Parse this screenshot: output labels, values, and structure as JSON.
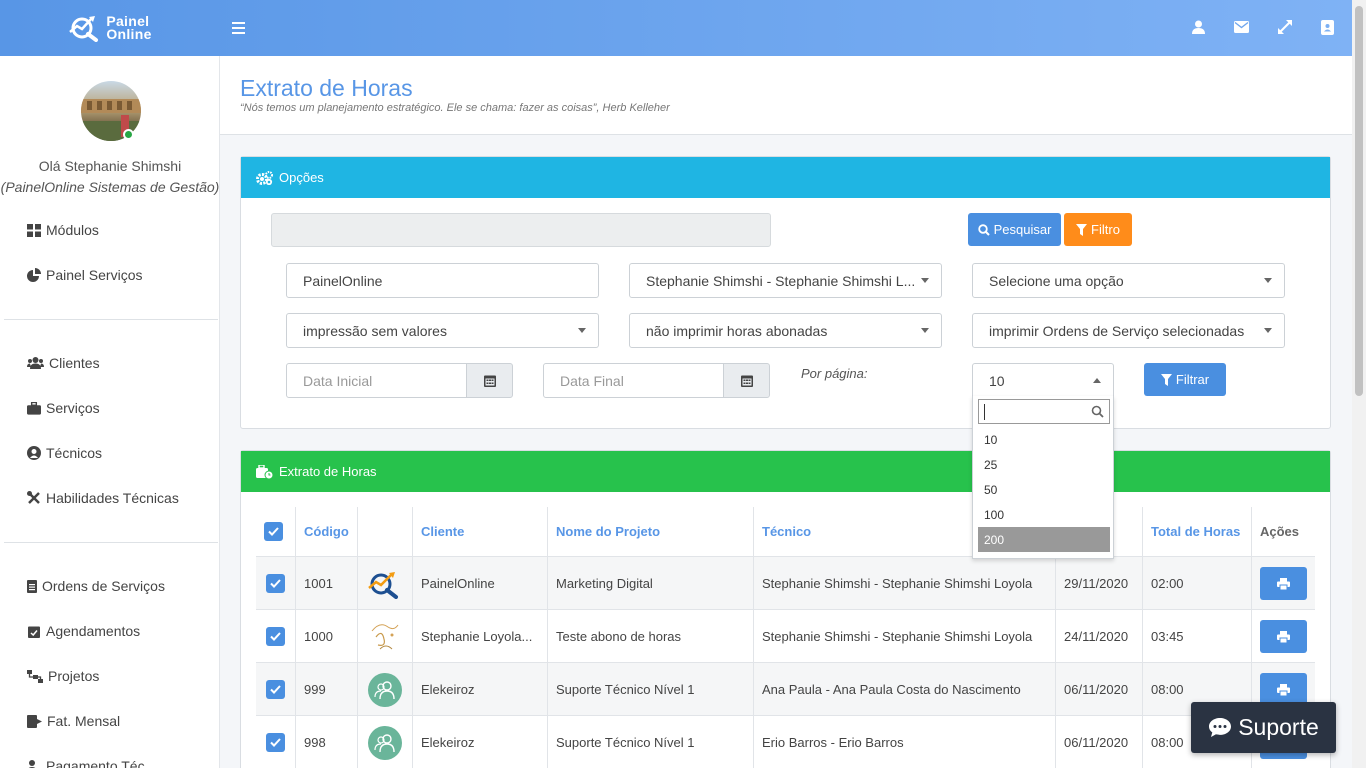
{
  "brand": {
    "line1": "Painel",
    "line2": "Online"
  },
  "topbar": {
    "icons": [
      "user-icon",
      "envelope-icon",
      "expand-icon",
      "address-book-icon"
    ]
  },
  "sidebar": {
    "greeting": "Olá Stephanie Shimshi",
    "company": "(PainelOnline Sistemas de Gestão)",
    "items": [
      {
        "label": "Módulos",
        "icon": "grid-icon"
      },
      {
        "label": "Painel Serviços",
        "icon": "pie-chart-icon"
      },
      {
        "label": "Clientes",
        "icon": "users-icon"
      },
      {
        "label": "Serviços",
        "icon": "briefcase-icon"
      },
      {
        "label": "Técnicos",
        "icon": "user-circle-icon"
      },
      {
        "label": "Habilidades Técnicas",
        "icon": "tools-icon"
      },
      {
        "label": "Ordens de Serviços",
        "icon": "file-list-icon"
      },
      {
        "label": "Agendamentos",
        "icon": "calendar-check-icon"
      },
      {
        "label": "Projetos",
        "icon": "sitemap-icon"
      },
      {
        "label": "Fat. Mensal",
        "icon": "file-export-icon"
      },
      {
        "label": "Pagamento Téc.",
        "icon": "user-money-icon"
      }
    ]
  },
  "page": {
    "title": "Extrato de Horas",
    "quote": "“Nós temos um planejamento estratégico. Ele se chama: fazer as coisas”, Herb Kelleher"
  },
  "options": {
    "header": "Opções",
    "search_button": "Pesquisar",
    "filter_button": "Filtro",
    "client_select": "PainelOnline",
    "technician_select": "Stephanie Shimshi - Stephanie Shimshi L...",
    "option_select": "Selecione uma opção",
    "print_values_select": "impressão sem valores",
    "hours_select": "não imprimir horas abonadas",
    "orders_select": "imprimir Ordens de Serviço selecionadas",
    "start_date_placeholder": "Data Inicial",
    "end_date_placeholder": "Data Final",
    "per_page_label": "Por página:",
    "per_page_value": "10",
    "per_page_options": [
      "10",
      "25",
      "50",
      "100",
      "200"
    ],
    "per_page_highlighted": "200",
    "apply_button": "Filtrar"
  },
  "table_card": {
    "header": "Extrato de Horas",
    "columns": [
      "Código",
      "Cliente",
      "Nome do Projeto",
      "Técnico",
      "Total de Horas",
      "Ações"
    ],
    "rows": [
      {
        "code": "1001",
        "logo": "painelonline-logo",
        "client": "PainelOnline",
        "project": "Marketing Digital",
        "technician": "Stephanie Shimshi - Stephanie Shimshi Loyola",
        "date": "29/11/2020",
        "hours": "02:00"
      },
      {
        "code": "1000",
        "logo": "signature-logo",
        "client": "Stephanie Loyola...",
        "project": "Teste abono de horas",
        "technician": "Stephanie Shimshi - Stephanie Shimshi Loyola",
        "date": "24/11/2020",
        "hours": "03:45"
      },
      {
        "code": "999",
        "logo": "users-round-logo",
        "client": "Elekeiroz",
        "project": "Suporte Técnico Nível 1",
        "technician": "Ana Paula - Ana Paula Costa do Nascimento",
        "date": "06/11/2020",
        "hours": "08:00"
      },
      {
        "code": "998",
        "logo": "users-round-logo",
        "client": "Elekeiroz",
        "project": "Suporte Técnico Nível 1",
        "technician": "Erio Barros - Erio Barros",
        "date": "06/11/2020",
        "hours": "08:00"
      }
    ]
  },
  "support_button": "Suporte",
  "colors": {
    "primary": "#5896e6",
    "info": "#1fb5e3",
    "success": "#27c24c",
    "warning": "#ff8c1a",
    "dark": "#2a3342"
  }
}
